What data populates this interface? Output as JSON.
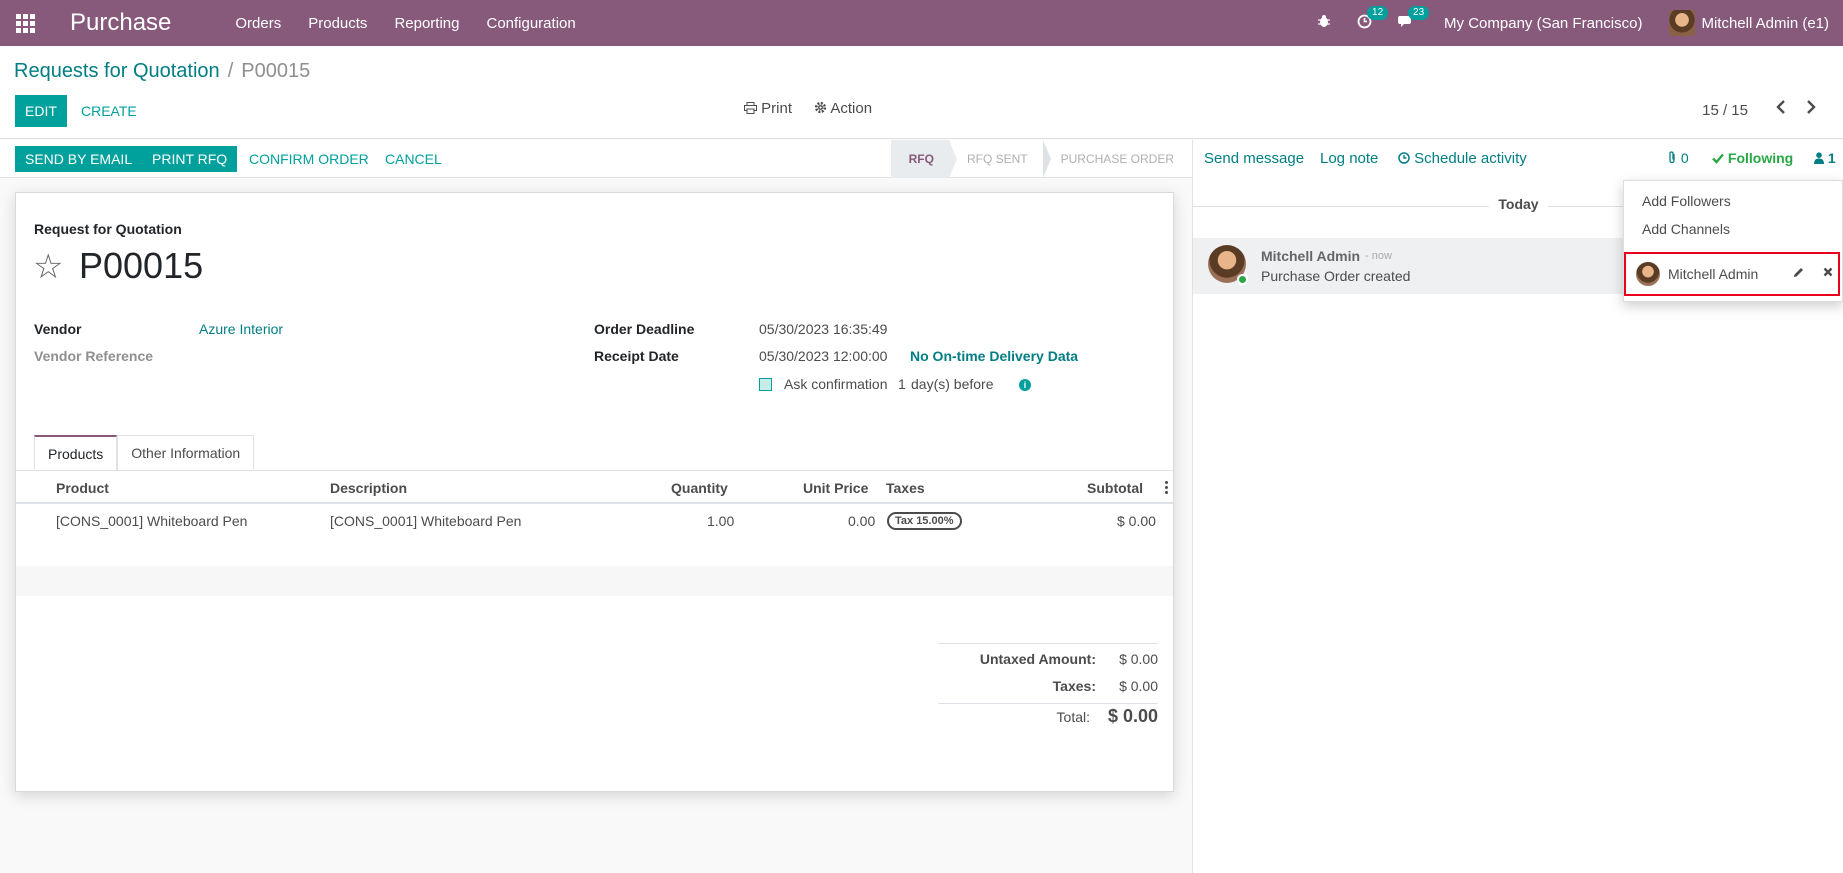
{
  "topbar": {
    "app_name": "Purchase",
    "menu": [
      "Orders",
      "Products",
      "Reporting",
      "Configuration"
    ],
    "activity_count": "12",
    "message_count": "23",
    "company": "My Company (San Francisco)",
    "user": "Mitchell Admin (e1)"
  },
  "breadcrumb": {
    "parent": "Requests for Quotation",
    "separator": "/",
    "current": "P00015"
  },
  "controls": {
    "edit": "EDIT",
    "create": "CREATE",
    "print": "Print",
    "action": "Action",
    "pager": "15 / 15",
    "prev_icon": "‹",
    "next_icon": "›"
  },
  "statusbar": {
    "send_by_email": "SEND BY EMAIL",
    "print_rfq": "PRINT RFQ",
    "confirm_order": "CONFIRM ORDER",
    "cancel": "CANCEL",
    "stages": [
      "RFQ",
      "RFQ SENT",
      "PURCHASE ORDER"
    ],
    "current_stage": "RFQ"
  },
  "form": {
    "title_label": "Request for Quotation",
    "name": "P00015",
    "vendor_label": "Vendor",
    "vendor": "Azure Interior",
    "vendor_ref_label": "Vendor Reference",
    "deadline_label": "Order Deadline",
    "deadline": "05/30/2023 16:35:49",
    "receipt_label": "Receipt Date",
    "receipt": "05/30/2023 12:00:00",
    "ontime": "No On-time Delivery Data",
    "ask_confirmation": "Ask confirmation",
    "days": "1",
    "days_suffix": "day(s) before",
    "info_icon": "i"
  },
  "tabs": [
    "Products",
    "Other Information"
  ],
  "table": {
    "columns": [
      "Product",
      "Description",
      "Quantity",
      "Unit Price",
      "Taxes",
      "Subtotal"
    ],
    "rows": [
      {
        "product": "[CONS_0001] Whiteboard Pen",
        "description": "[CONS_0001] Whiteboard Pen",
        "quantity": "1.00",
        "unit_price": "0.00",
        "taxes": "Tax 15.00%",
        "subtotal": "$ 0.00"
      }
    ]
  },
  "totals": {
    "untaxed_label": "Untaxed Amount:",
    "untaxed": "$ 0.00",
    "taxes_label": "Taxes:",
    "taxes": "$ 0.00",
    "total_label": "Total:",
    "total": "$ 0.00"
  },
  "chatter": {
    "send_message": "Send message",
    "log_note": "Log note",
    "schedule_activity": "Schedule activity",
    "attachments_count": "0",
    "following": "Following",
    "followers_count": "1",
    "today": "Today",
    "message": {
      "author": "Mitchell Admin",
      "time": "- now",
      "body": "Purchase Order created"
    }
  },
  "followers_dropdown": {
    "add_followers": "Add Followers",
    "add_channels": "Add Channels",
    "follower": "Mitchell Admin"
  },
  "colors": {
    "brand": "#875a7b",
    "primary": "#00a09d",
    "link": "#017e84",
    "following": "#28a745",
    "highlight": "#e8001c"
  }
}
